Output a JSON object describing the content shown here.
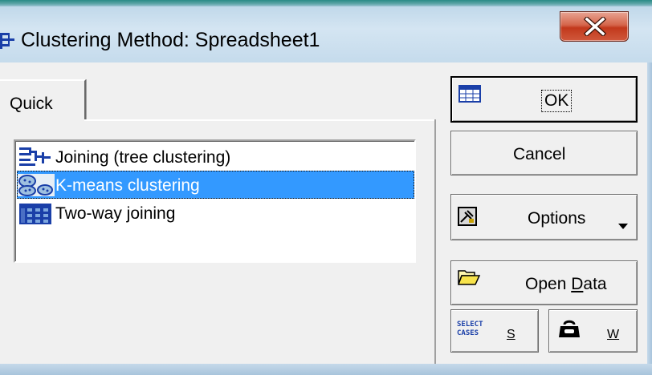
{
  "window": {
    "title": "Clustering Method: Spreadsheet1",
    "close_label": "X"
  },
  "tabs": [
    {
      "label": "Quick",
      "active": true
    }
  ],
  "method_list": {
    "items": [
      {
        "label": "Joining (tree clustering)",
        "icon": "tree-clustering-icon",
        "selected": false
      },
      {
        "label": "K-means clustering",
        "icon": "k-means-icon",
        "selected": true
      },
      {
        "label": "Two-way joining",
        "icon": "two-way-joining-icon",
        "selected": false
      }
    ]
  },
  "buttons": {
    "ok": {
      "label": "OK",
      "icon": "spreadsheet-icon"
    },
    "cancel": {
      "label": "Cancel"
    },
    "options": {
      "label": "Options",
      "icon": "options-icon",
      "arrow": "dropdown-arrow-icon"
    },
    "open_data": {
      "label_prefix": "Open ",
      "label_underlined": "D",
      "label_suffix": "ata",
      "icon": "folder-open-icon"
    },
    "select_cases": {
      "label": "S",
      "icon_text": [
        "SELECT",
        "CASES"
      ]
    },
    "weight": {
      "label": "W",
      "icon": "weight-icon"
    }
  },
  "colors": {
    "selection": "#3399ff",
    "window_face": "#f0f0f0",
    "close_button": "#c9472a"
  }
}
